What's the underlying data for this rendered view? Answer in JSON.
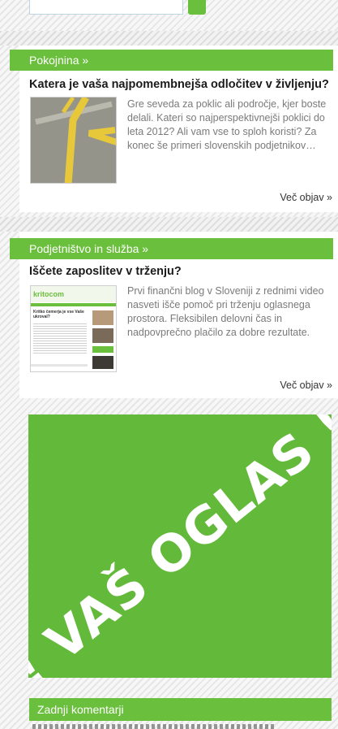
{
  "section_pokojnina": {
    "title": "Pokojnina »",
    "article_title": "Katera je vaša najpomembnejša odločitev v življenju?",
    "excerpt": "Gre seveda za poklic ali področje, kjer boste delali. Kateri so najperspektivnejši poklici do leta 2012? Ali vam vse to sploh koristi? Za konec še primeri slovenskih podjetnikov…",
    "more_link": "Več objav »"
  },
  "section_podjetnistvo": {
    "title": "Podjetništvo in služba »",
    "article_title": "Iščete zaposlitev v trženju?",
    "excerpt": "Prvi finančni blog v Sloveniji z rednimi video nasveti išče pomoč pri trženju oglasnega prostora. Fleksibilen delovni čas in nadpovprečno plačilo za dobre rezultate.",
    "more_link": "Več objav »",
    "thumb_logo": "kritocom",
    "thumb_heading": "Kritko čemerja je vse Vaše ukroval?"
  },
  "ad": {
    "text": "!! VAŠ OGLAS !!"
  },
  "comments": {
    "title": "Zadnji komentarji"
  },
  "colors": {
    "accent_green": "#6abf3c",
    "ad_green": "#63b93a"
  }
}
